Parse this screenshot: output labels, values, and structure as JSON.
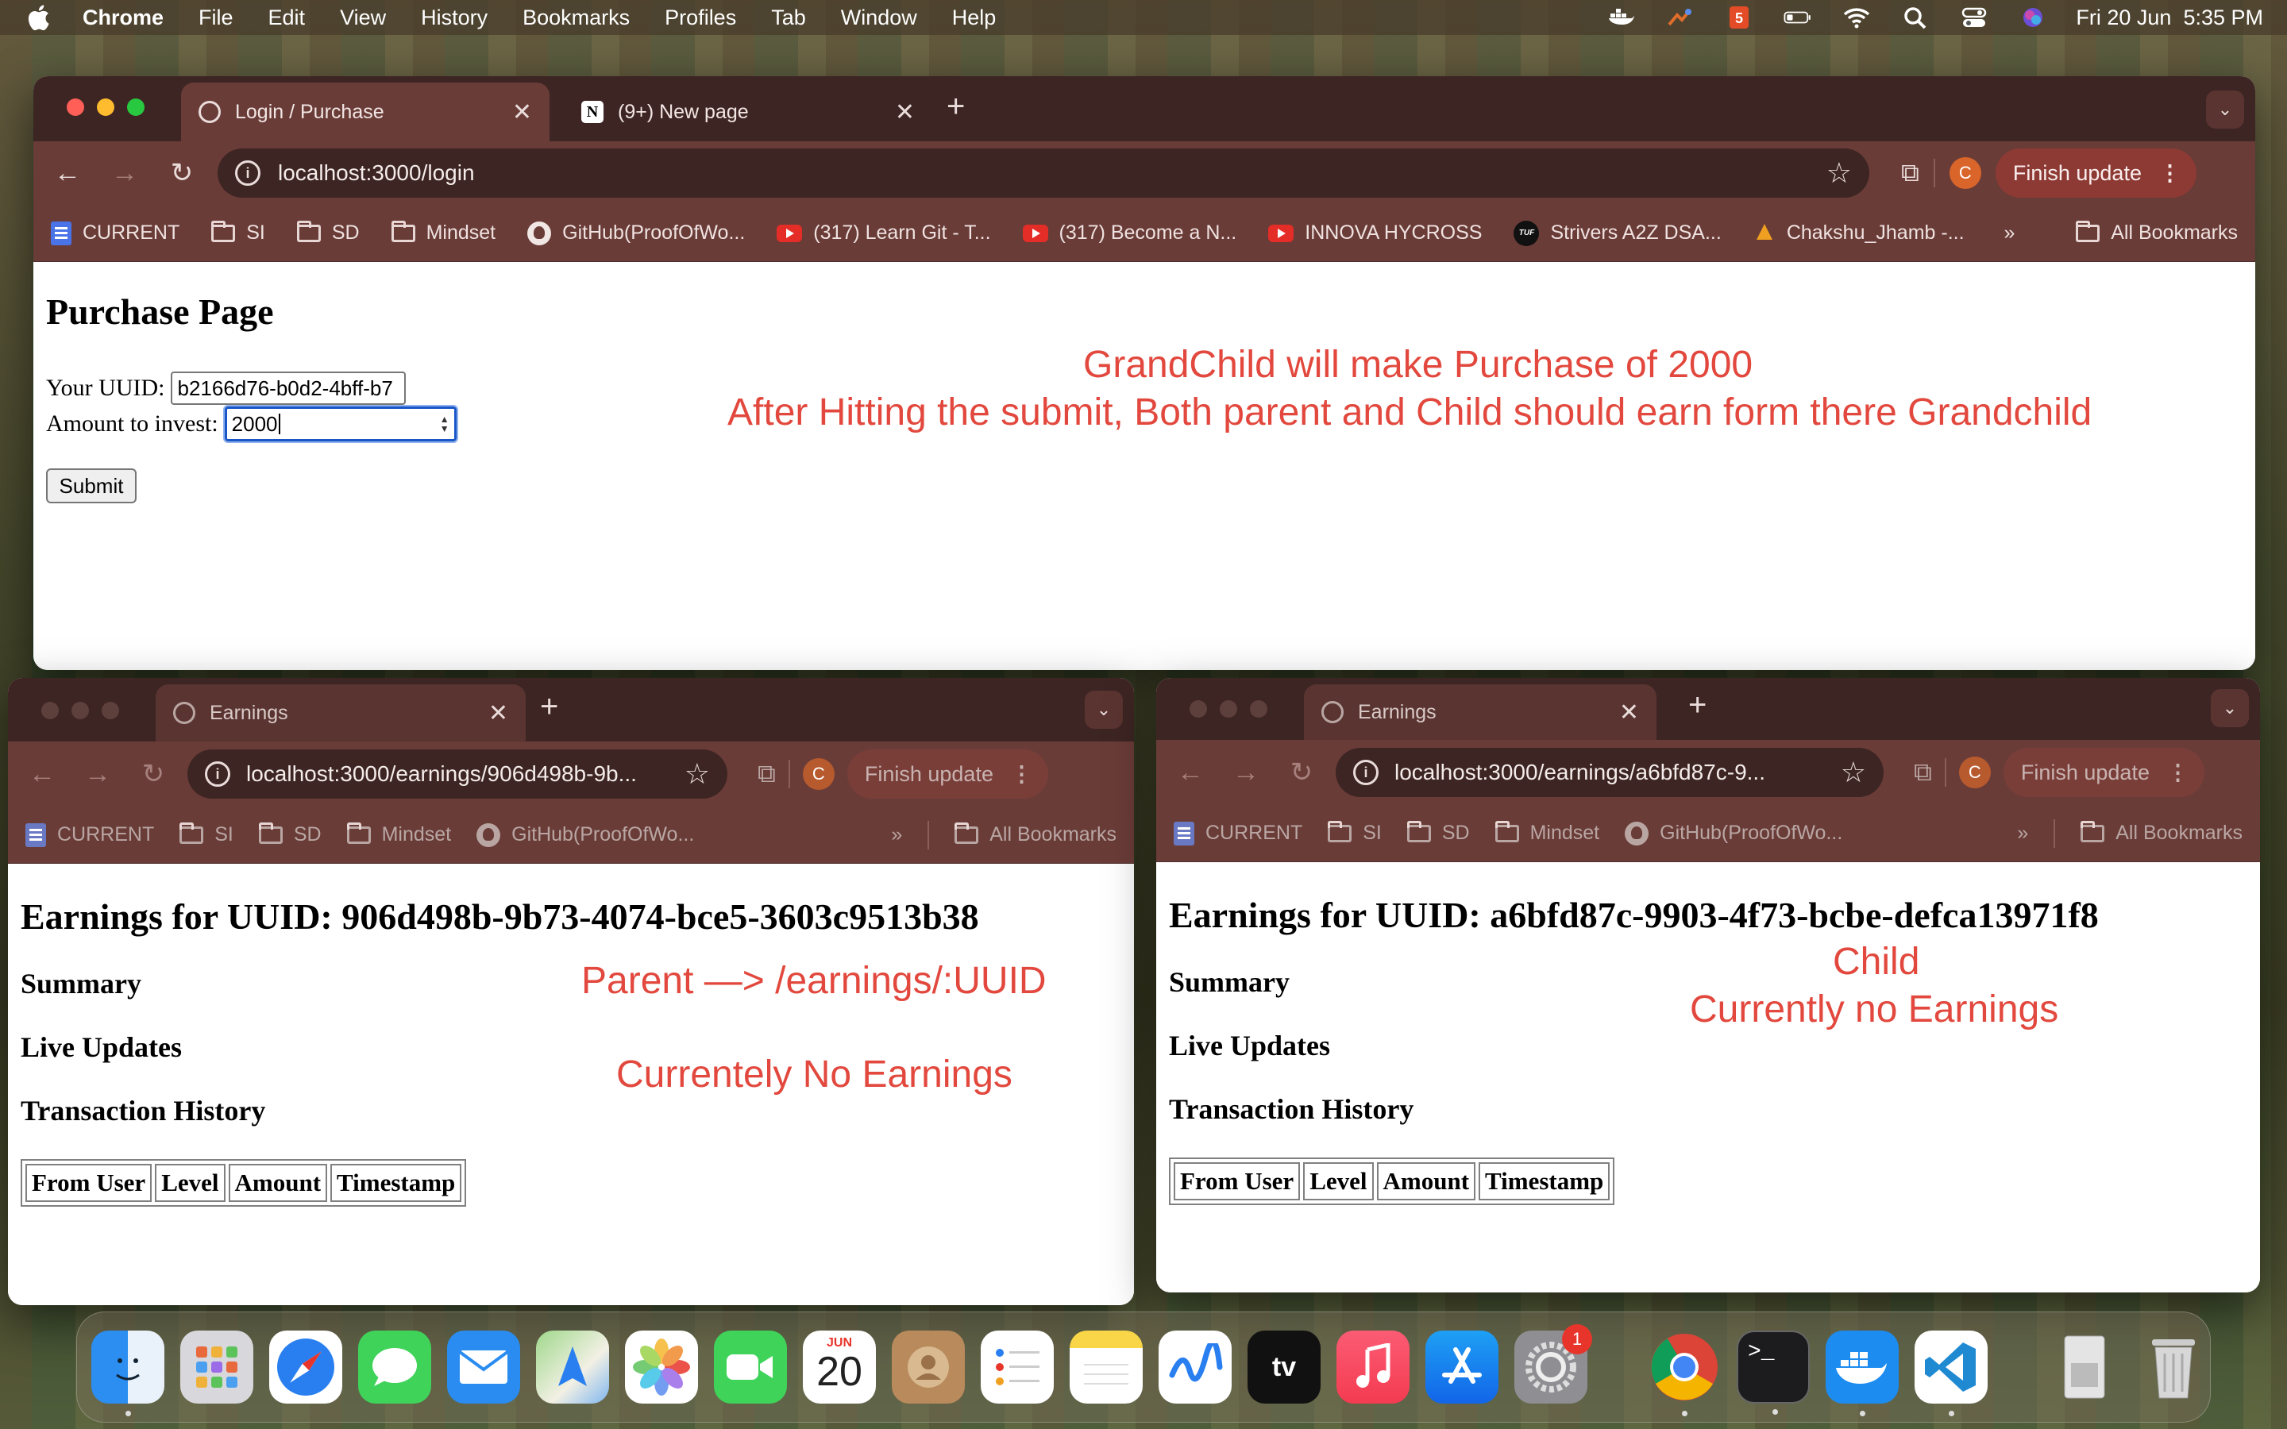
{
  "menubar": {
    "app_name": "Chrome",
    "items": [
      "File",
      "Edit",
      "View",
      "History",
      "Bookmarks",
      "Profiles",
      "Tab",
      "Window",
      "Help"
    ],
    "datetime": "Fri 20 Jun  5:35 PM"
  },
  "main_window": {
    "tabs": [
      {
        "title": "Login / Purchase"
      },
      {
        "title": "(9+) New page"
      }
    ],
    "url": "localhost:3000/login",
    "finish_update": "Finish update",
    "profile_initial": "C",
    "bookmarks": [
      {
        "label": "CURRENT",
        "icon": "doc-icon"
      },
      {
        "label": "SI",
        "icon": "folder-icon"
      },
      {
        "label": "SD",
        "icon": "folder-icon"
      },
      {
        "label": "Mindset",
        "icon": "folder-icon"
      },
      {
        "label": "GitHub(ProofOfWo...",
        "icon": "github-icon"
      },
      {
        "label": "(317) Learn Git - T...",
        "icon": "youtube-icon"
      },
      {
        "label": "(317) Become a N...",
        "icon": "youtube-icon"
      },
      {
        "label": "INNOVA HYCROSS",
        "icon": "youtube-icon"
      },
      {
        "label": "Strivers A2Z DSA...",
        "icon": "tuf-icon"
      },
      {
        "label": "Chakshu_Jhamb -...",
        "icon": "chakshu-icon"
      }
    ],
    "all_bookmarks": "All Bookmarks",
    "page": {
      "title": "Purchase Page",
      "uuid_label": "Your UUID:",
      "uuid_value": "b2166d76-b0d2-4bff-b7",
      "amount_label": "Amount to invest:",
      "amount_value": "2000",
      "submit_label": "Submit",
      "annotation_line1": "GrandChild will make Purchase of 2000",
      "annotation_line2": "After Hitting the submit, Both parent and Child should earn form there Grandchild"
    }
  },
  "left_window": {
    "tab_title": "Earnings",
    "url": "localhost:3000/earnings/906d498b-9b...",
    "finish_update": "Finish update",
    "profile_initial": "C",
    "bookmarks": [
      {
        "label": "CURRENT",
        "icon": "doc-icon"
      },
      {
        "label": "SI",
        "icon": "folder-icon"
      },
      {
        "label": "SD",
        "icon": "folder-icon"
      },
      {
        "label": "Mindset",
        "icon": "folder-icon"
      },
      {
        "label": "GitHub(ProofOfWo...",
        "icon": "github-icon"
      }
    ],
    "all_bookmarks": "All Bookmarks",
    "page": {
      "title": "Earnings for UUID: 906d498b-9b73-4074-bce5-3603c9513b38",
      "summary": "Summary",
      "live_updates": "Live Updates",
      "history": "Transaction History",
      "columns": [
        "From User",
        "Level",
        "Amount",
        "Timestamp"
      ],
      "annotation_line1": "Parent —> /earnings/:UUID",
      "annotation_line2": "Currentely No Earnings"
    }
  },
  "right_window": {
    "tab_title": "Earnings",
    "url": "localhost:3000/earnings/a6bfd87c-9...",
    "finish_update": "Finish update",
    "profile_initial": "C",
    "bookmarks": [
      {
        "label": "CURRENT",
        "icon": "doc-icon"
      },
      {
        "label": "SI",
        "icon": "folder-icon"
      },
      {
        "label": "SD",
        "icon": "folder-icon"
      },
      {
        "label": "Mindset",
        "icon": "folder-icon"
      },
      {
        "label": "GitHub(ProofOfWo...",
        "icon": "github-icon"
      }
    ],
    "all_bookmarks": "All Bookmarks",
    "page": {
      "title": "Earnings for UUID: a6bfd87c-9903-4f73-bcbe-defca13971f8",
      "summary": "Summary",
      "live_updates": "Live Updates",
      "history": "Transaction History",
      "columns": [
        "From User",
        "Level",
        "Amount",
        "Timestamp"
      ],
      "annotation_line1": "Child",
      "annotation_line2": "Currently no Earnings"
    }
  },
  "dock": {
    "calendar_month": "JUN",
    "calendar_day": "20",
    "settings_badge": "1",
    "apps": [
      "Finder",
      "Launchpad",
      "Safari",
      "Messages",
      "Mail",
      "Maps",
      "Photos",
      "FaceTime",
      "Calendar",
      "Contacts",
      "Reminders",
      "Notes",
      "Freeform",
      "TV",
      "Music",
      "App Store",
      "System Settings",
      "Chrome",
      "Terminal",
      "Docker",
      "VS Code",
      "Downloads",
      "Trash"
    ]
  },
  "colors": {
    "chrome_frame": "#3d2523",
    "chrome_toolbar": "#6a3c38",
    "finish_update": "#8c3a33",
    "annotation": "#e2483d",
    "input_focus": "#1a56c7"
  }
}
